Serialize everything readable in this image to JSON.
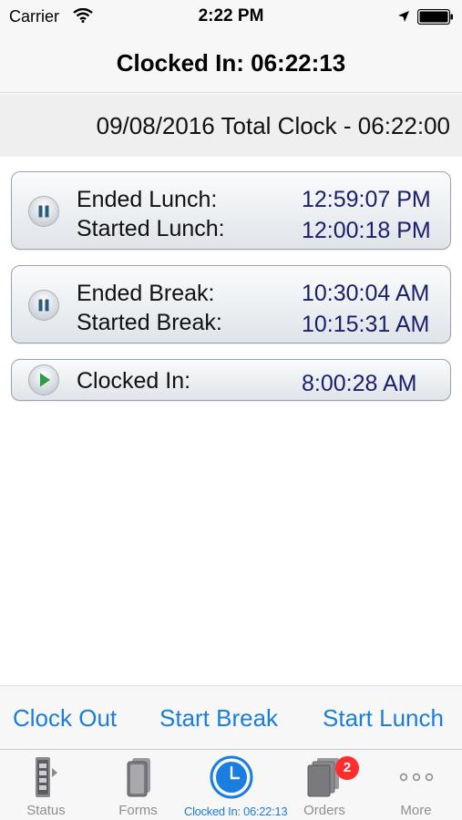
{
  "status_bar": {
    "carrier": "Carrier",
    "time": "2:22 PM",
    "icons": [
      "wifi-icon",
      "location-arrow-icon",
      "battery-icon"
    ]
  },
  "nav": {
    "title": "Clocked In: 06:22:13"
  },
  "total_clock": {
    "text": "09/08/2016 Total Clock - 06:22:00"
  },
  "events": [
    {
      "icon": "pause-icon",
      "rows": [
        {
          "label": "Ended Lunch:",
          "time": "12:59:07 PM"
        },
        {
          "label": "Started Lunch:",
          "time": "12:00:18 PM"
        }
      ]
    },
    {
      "icon": "pause-icon",
      "rows": [
        {
          "label": "Ended Break:",
          "time": "10:30:04 AM"
        },
        {
          "label": "Started Break:",
          "time": "10:15:31 AM"
        }
      ]
    },
    {
      "icon": "play-icon",
      "rows": [
        {
          "label": "Clocked In:",
          "time": "8:00:28 AM"
        }
      ]
    }
  ],
  "actions": {
    "clock_out": "Clock Out",
    "start_break": "Start Break",
    "start_lunch": "Start Lunch"
  },
  "tabs": [
    {
      "label": "Status",
      "icon": "traffic-light-icon"
    },
    {
      "label": "Forms",
      "icon": "forms-icon"
    },
    {
      "label": "Clocked In: 06:22:13",
      "icon": "clock-icon",
      "active": true
    },
    {
      "label": "Orders",
      "icon": "orders-icon",
      "badge": "2"
    },
    {
      "label": "More",
      "icon": "more-icon"
    }
  ],
  "colors": {
    "accent": "#1a7de0",
    "time_text": "#1a1e6e",
    "badge": "#ff2d2d",
    "play_green": "#2f9a4a"
  }
}
